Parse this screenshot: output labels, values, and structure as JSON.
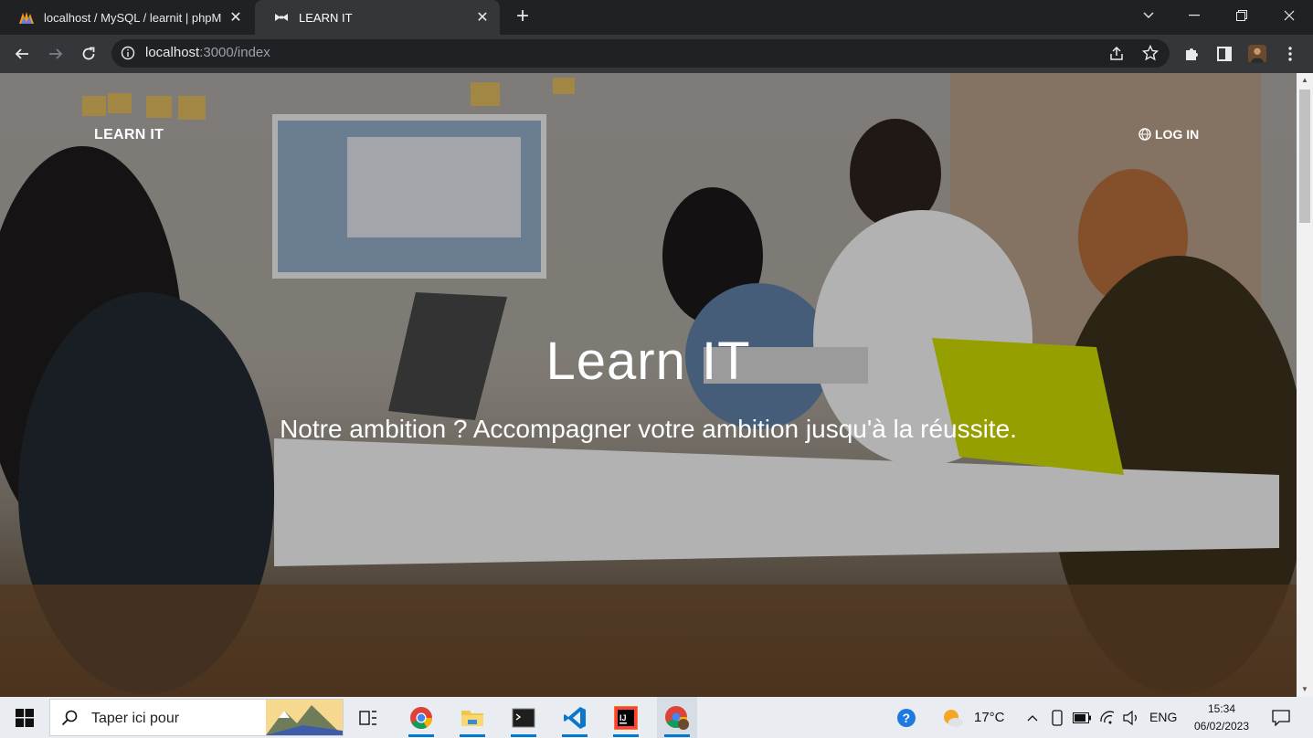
{
  "browser": {
    "tabs": [
      {
        "title": "localhost / MySQL / learnit | phpM",
        "active": false,
        "icon": "phpmyadmin-icon"
      },
      {
        "title": "LEARN IT",
        "active": true,
        "icon": "bowtie-icon"
      }
    ],
    "url_host": "localhost",
    "url_path": ":3000/index"
  },
  "page": {
    "brand": "LEARN IT",
    "login_label": "LOG IN",
    "hero_title": "Learn IT",
    "hero_subtitle": "Notre ambition ? Accompagner votre ambition jusqu'à la réussite."
  },
  "taskbar": {
    "search_placeholder": "Taper ici pour",
    "weather_temp": "17°C",
    "language": "ENG",
    "time": "15:34",
    "date": "06/02/2023"
  },
  "colors": {
    "tabstrip": "#202124",
    "toolbar": "#35363a",
    "taskbar": "#e9edf1",
    "accent": "#0078d4"
  }
}
